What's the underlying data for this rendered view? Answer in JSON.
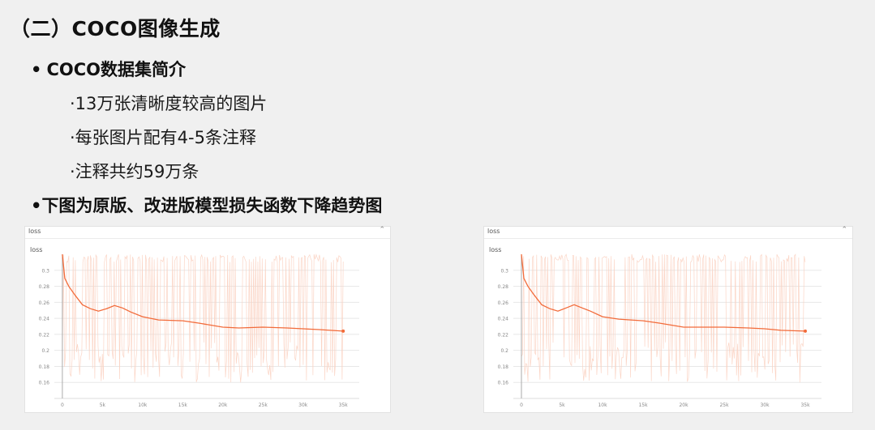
{
  "title": "（二）COCO图像生成",
  "bullets": [
    {
      "text": "COCO数据集简介",
      "prefix": "•"
    },
    {
      "text": "下图为原版、改进版模型损失函数下降趋势图",
      "prefix": "•"
    }
  ],
  "sub_items": [
    "·13万张清晰度较高的图片",
    "·每张图片配有4-5条注释",
    "·注释共约59万条"
  ],
  "panels": [
    {
      "header_label": "loss",
      "collapse_icon": "chevron-up-icon",
      "chart_title": "loss"
    },
    {
      "header_label": "loss",
      "collapse_icon": "chevron-up-icon",
      "chart_title": "loss"
    }
  ],
  "colors": {
    "smoothed": "#f26b3a",
    "raw": "#fbd0c0",
    "grid": "#e8e8e8"
  },
  "chart_data": [
    {
      "type": "line",
      "title": "loss",
      "x_ticks": [
        0,
        5000,
        10000,
        15000,
        20000,
        25000,
        30000,
        35000
      ],
      "x_tick_labels": [
        "0",
        "5k",
        "10k",
        "15k",
        "20k",
        "25k",
        "30k",
        "35k"
      ],
      "y_ticks": [
        0.16,
        0.18,
        0.2,
        0.22,
        0.24,
        0.26,
        0.28,
        0.3
      ],
      "y_tick_labels": [
        "0.16",
        "0.18",
        "0.2",
        "0.22",
        "0.24",
        "0.26",
        "0.28",
        "0.3"
      ],
      "xlim": [
        -1000,
        37000
      ],
      "ylim": [
        0.14,
        0.32
      ],
      "series": [
        {
          "x": [
            0,
            300,
            800,
            1500,
            2500,
            3500,
            4500,
            5500,
            6500,
            7500,
            8500,
            10000,
            12000,
            15000,
            17000,
            20000,
            22000,
            25000,
            28000,
            30000,
            32000,
            35000
          ],
          "y": [
            0.32,
            0.29,
            0.28,
            0.27,
            0.257,
            0.252,
            0.249,
            0.252,
            0.256,
            0.253,
            0.248,
            0.242,
            0.238,
            0.237,
            0.234,
            0.229,
            0.228,
            0.229,
            0.228,
            0.227,
            0.226,
            0.224
          ]
        }
      ]
    },
    {
      "type": "line",
      "title": "loss",
      "x_ticks": [
        0,
        5000,
        10000,
        15000,
        20000,
        25000,
        30000,
        35000
      ],
      "x_tick_labels": [
        "0",
        "5k",
        "10k",
        "15k",
        "20k",
        "25k",
        "30k",
        "35k"
      ],
      "y_ticks": [
        0.16,
        0.18,
        0.2,
        0.22,
        0.24,
        0.26,
        0.28,
        0.3
      ],
      "y_tick_labels": [
        "0.16",
        "0.18",
        "0.2",
        "0.22",
        "0.24",
        "0.26",
        "0.28",
        "0.3"
      ],
      "xlim": [
        -1000,
        37000
      ],
      "ylim": [
        0.14,
        0.32
      ],
      "series": [
        {
          "x": [
            0,
            300,
            800,
            1500,
            2500,
            3500,
            4500,
            5500,
            6500,
            7500,
            8500,
            10000,
            12000,
            15000,
            17000,
            20000,
            22000,
            25000,
            28000,
            30000,
            32000,
            35000
          ],
          "y": [
            0.32,
            0.29,
            0.28,
            0.27,
            0.257,
            0.252,
            0.249,
            0.253,
            0.257,
            0.253,
            0.249,
            0.242,
            0.239,
            0.237,
            0.234,
            0.229,
            0.229,
            0.229,
            0.228,
            0.227,
            0.225,
            0.224
          ]
        }
      ]
    }
  ]
}
